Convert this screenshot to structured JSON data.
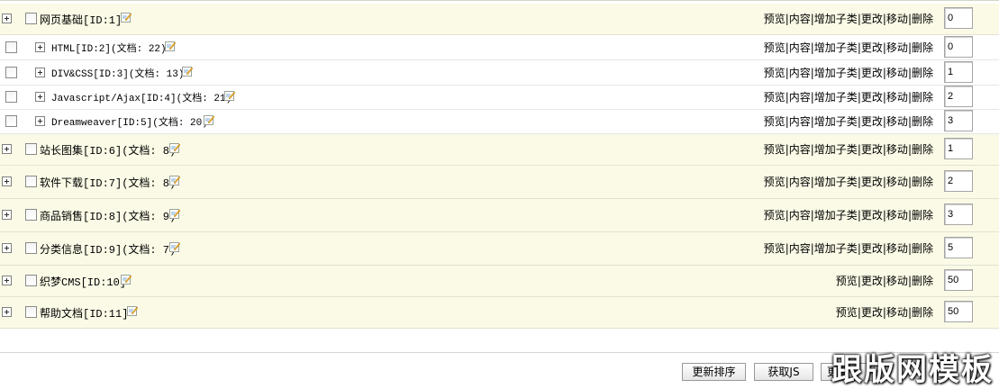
{
  "categories": [
    {
      "type": "top",
      "expander": true,
      "name": "网页基础[ID:1]",
      "actions": [
        "预览",
        "内容",
        "增加子类",
        "更改",
        "移动",
        "删除"
      ],
      "order": "0"
    },
    {
      "type": "sub",
      "name": "HTML[ID:2](文档: 22)",
      "actions": [
        "预览",
        "内容",
        "增加子类",
        "更改",
        "移动",
        "删除"
      ],
      "order": "0"
    },
    {
      "type": "sub",
      "name": "DIV&CSS[ID:3](文档: 13)",
      "actions": [
        "预览",
        "内容",
        "增加子类",
        "更改",
        "移动",
        "删除"
      ],
      "order": "1"
    },
    {
      "type": "sub",
      "name": "Javascript/Ajax[ID:4](文档: 21)",
      "actions": [
        "预览",
        "内容",
        "增加子类",
        "更改",
        "移动",
        "删除"
      ],
      "order": "2"
    },
    {
      "type": "sub",
      "name": "Dreamweaver[ID:5](文档: 20)",
      "actions": [
        "预览",
        "内容",
        "增加子类",
        "更改",
        "移动",
        "删除"
      ],
      "order": "3"
    },
    {
      "type": "top",
      "expander": true,
      "name": "站长图集[ID:6](文档: 8)",
      "actions": [
        "预览",
        "内容",
        "增加子类",
        "更改",
        "移动",
        "删除"
      ],
      "order": "1"
    },
    {
      "type": "top",
      "expander": true,
      "name": "软件下载[ID:7](文档: 8)",
      "actions": [
        "预览",
        "内容",
        "增加子类",
        "更改",
        "移动",
        "删除"
      ],
      "order": "2"
    },
    {
      "type": "top",
      "expander": true,
      "name": "商品销售[ID:8](文档: 9)",
      "actions": [
        "预览",
        "内容",
        "增加子类",
        "更改",
        "移动",
        "删除"
      ],
      "order": "3"
    },
    {
      "type": "top",
      "expander": true,
      "name": "分类信息[ID:9](文档: 7)",
      "actions": [
        "预览",
        "内容",
        "增加子类",
        "更改",
        "移动",
        "删除"
      ],
      "order": "5"
    },
    {
      "type": "top",
      "expander": true,
      "name": "织梦CMS[ID:10]",
      "actions": [
        "预览",
        "更改",
        "移动",
        "删除"
      ],
      "order": "50"
    },
    {
      "type": "top",
      "expander": true,
      "name": "帮助文档[ID:11]",
      "actions": [
        "预览",
        "更改",
        "移动",
        "删除"
      ],
      "order": "50"
    }
  ],
  "buttons": {
    "update_sort": "更新排序",
    "get_js": "获取JS",
    "update_partial": "更新"
  },
  "watermark": "跟版网模板",
  "colors": {
    "row_top_bg": "#fafae6",
    "row_sub_bg": "#ffffff"
  }
}
